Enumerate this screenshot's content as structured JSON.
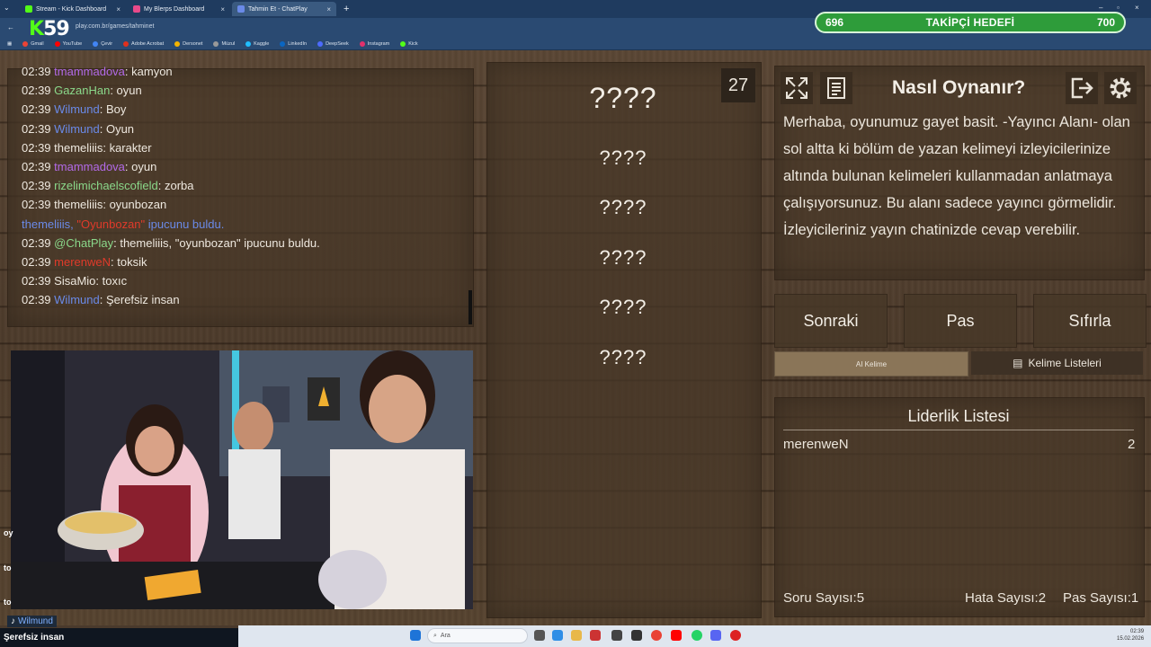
{
  "browser": {
    "tabs": [
      {
        "label": "Stream - Kick Dashboard",
        "color": "#53fc18",
        "active": false
      },
      {
        "label": "My Blerps Dashboard",
        "color": "#e84a8a",
        "active": false
      },
      {
        "label": "Tahmin Et - ChatPlay",
        "color": "#6a8ae8",
        "active": true
      }
    ],
    "url": "play.com.br/games/tahminet",
    "bookmarks": [
      {
        "label": "Gmail",
        "color": "#ea4335"
      },
      {
        "label": "YouTube",
        "color": "#ff0000"
      },
      {
        "label": "Çevir",
        "color": "#4285f4"
      },
      {
        "label": "Adobe Acrobat",
        "color": "#e0301e"
      },
      {
        "label": "Dersonet",
        "color": "#f4b400"
      },
      {
        "label": "Müzul",
        "color": "#999999"
      },
      {
        "label": "Kaggle",
        "color": "#20beff"
      },
      {
        "label": "LinkedIn",
        "color": "#0a66c2"
      },
      {
        "label": "DeepSeek",
        "color": "#4d6bfe"
      },
      {
        "label": "Instagram",
        "color": "#e1306c"
      },
      {
        "label": "Kick",
        "color": "#53fc18"
      }
    ]
  },
  "kick_logo": {
    "k": "K",
    "number": "59"
  },
  "follower_goal": {
    "current": "696",
    "title": "TAKİPÇİ HEDEFİ",
    "target": "700",
    "progress": 0.0
  },
  "chat": {
    "lines": [
      {
        "time": "02:39",
        "user": "tmammadova",
        "color": "#b36ae8",
        "msg": ": kamyon"
      },
      {
        "time": "02:39",
        "user": "GazanHan",
        "color": "#8ad88a",
        "msg": ": oyun"
      },
      {
        "time": "02:39",
        "user": "Wilmund",
        "color": "#6a8ae8",
        "msg": ": Boy"
      },
      {
        "time": "02:39",
        "user": "Wilmund",
        "color": "#6a8ae8",
        "msg": ": Oyun"
      },
      {
        "time": "02:39",
        "user": "themeliiis",
        "color": "#eee8df",
        "msg": ": karakter"
      },
      {
        "time": "02:39",
        "user": "tmammadova",
        "color": "#b36ae8",
        "msg": ": oyun"
      },
      {
        "time": "02:39",
        "user": "rizelimichaelscofield",
        "color": "#8ad88a",
        "msg": ": zorba"
      },
      {
        "time": "02:39",
        "user": "themeliiis",
        "color": "#eee8df",
        "msg": ": oyunbozan"
      },
      {
        "time": "",
        "user": "themeliiis, ",
        "color": "#6a8ae8",
        "msg": "",
        "quote": "\"Oyunbozan\"",
        "suffix": " ipucunu buldu."
      },
      {
        "time": "02:39",
        "user": "@ChatPlay",
        "color": "#8ad88a",
        "msg": ": themeliiis, \"oyunbozan\" ipucunu buldu."
      },
      {
        "time": "02:39",
        "user": "merenweN",
        "color": "#e03a2a",
        "msg": ": toksik"
      },
      {
        "time": "02:39",
        "user": "SisaMio",
        "color": "#eee8df",
        "msg": ": toxıc"
      },
      {
        "time": "02:39",
        "user": "Wilmund",
        "color": "#6a8ae8",
        "msg": ": Şerefsiz insan"
      }
    ]
  },
  "words": {
    "items": [
      "????",
      "????",
      "????",
      "????",
      "????",
      "????"
    ],
    "counter": "27"
  },
  "howto": {
    "title": "Nasıl Oynanır?",
    "text": "Merhaba, oyunumuz gayet basit. -Yayıncı Alanı- olan sol altta ki bölüm de yazan kelimeyi izleyicilerinize altında bulunan kelimeleri kullanmadan anlatmaya çalışıyorsunuz. Bu alanı sadece yayıncı görmelidir. İzleyicileriniz yayın chatinizde cevap verebilir."
  },
  "actions": {
    "next": "Sonraki",
    "pass": "Pas",
    "reset": "Sıfırla",
    "ai": "AI Kelime",
    "lists": "Kelime Listeleri"
  },
  "leaderboard": {
    "title": "Liderlik Listesi",
    "entries": [
      {
        "name": "merenweN",
        "score": "2"
      }
    ],
    "stats": {
      "questions": "Soru Sayısı:5",
      "errors": "Hata Sayısı:2",
      "passes": "Pas Sayısı:1"
    }
  },
  "overlay": {
    "side_labels": [
      "oy",
      "to",
      "to"
    ],
    "name": "Wilmund",
    "message": "Şerefsiz insan"
  },
  "taskbar": {
    "search": "Ara",
    "time": "02:39",
    "date": "15.02.2026"
  }
}
